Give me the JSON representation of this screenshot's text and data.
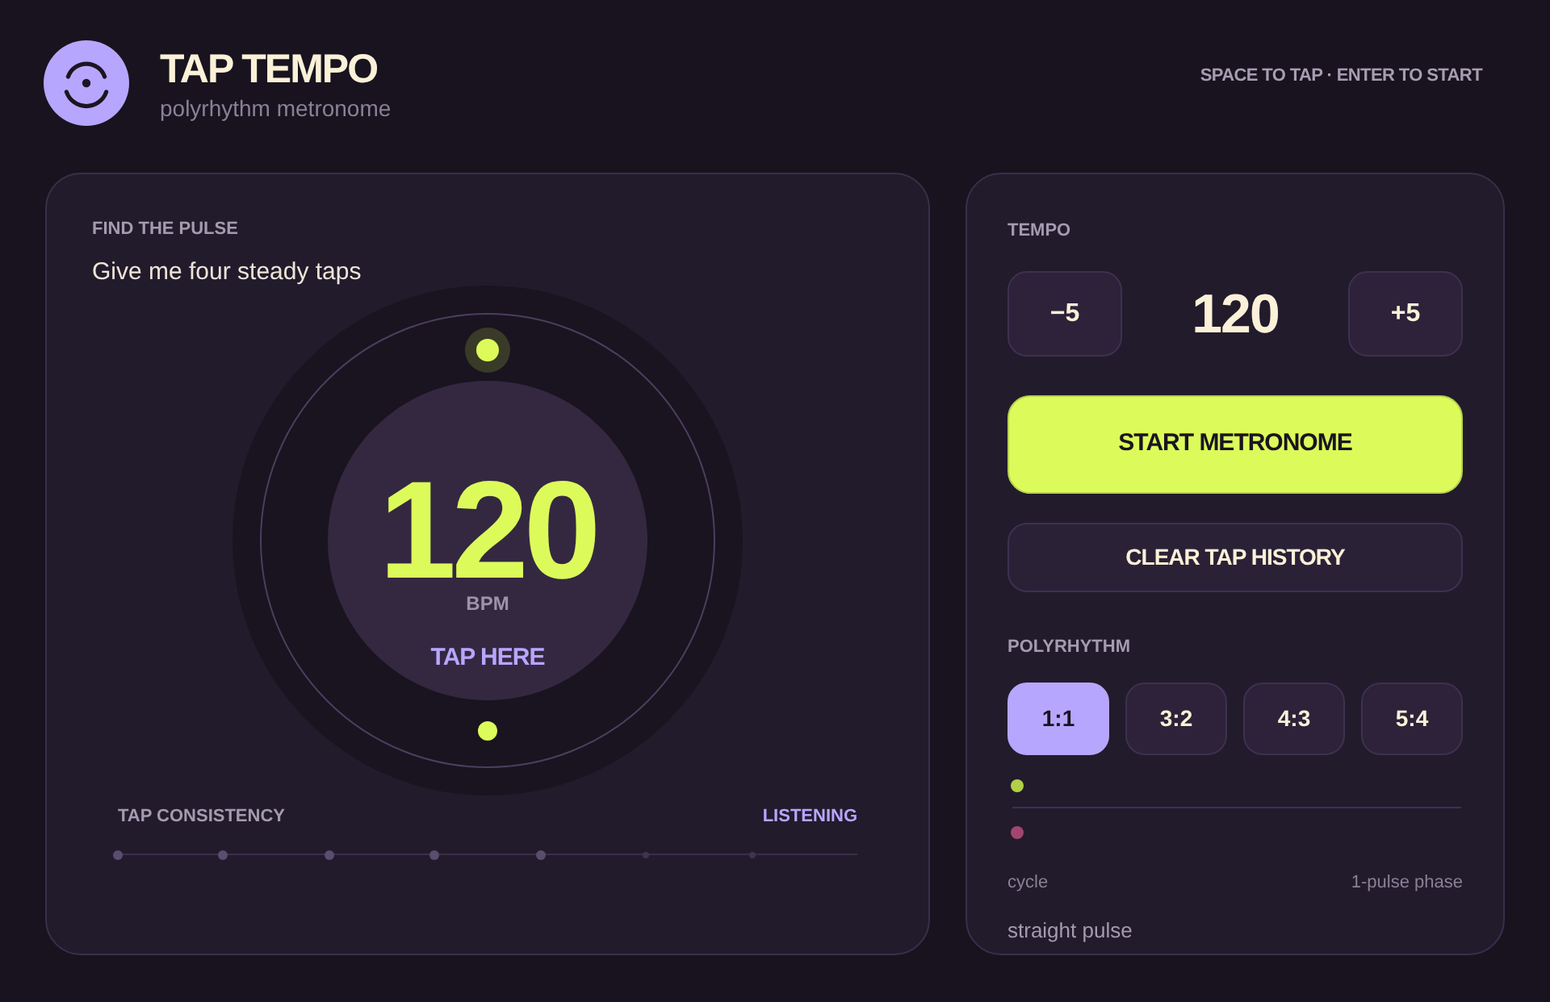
{
  "header": {
    "title": "TAP TEMPO",
    "subtitle": "polyrhythm metronome",
    "shortcuts": "SPACE TO TAP · ENTER TO START"
  },
  "tap_panel": {
    "label": "FIND THE PULSE",
    "prompt": "Give me four steady taps",
    "bpm": "120",
    "unit": "BPM",
    "action": "TAP HERE",
    "beat_dots": [
      {
        "active": true
      },
      {
        "active": false
      }
    ],
    "consistency": {
      "label": "TAP CONSISTENCY",
      "status": "LISTENING",
      "markers": [
        {
          "lit": true
        },
        {
          "lit": true
        },
        {
          "lit": true
        },
        {
          "lit": true
        },
        {
          "lit": true
        },
        {
          "lit": false
        },
        {
          "lit": false
        }
      ]
    }
  },
  "tempo_panel": {
    "label": "TEMPO",
    "decrement": "−5",
    "value": "120",
    "increment": "+5",
    "start_button": "START METRONOME",
    "clear_button": "CLEAR TAP HISTORY"
  },
  "polyrhythm": {
    "label": "POLYRHYTHM",
    "ratios": [
      {
        "label": "1:1",
        "selected": true
      },
      {
        "label": "3:2",
        "selected": false
      },
      {
        "label": "4:3",
        "selected": false
      },
      {
        "label": "5:4",
        "selected": false
      }
    ],
    "lanes": [
      {
        "color": "#b3cf48"
      },
      {
        "color": "#a3456f"
      }
    ],
    "axis_left": "cycle",
    "axis_right": "1-pulse phase",
    "description": "straight pulse"
  }
}
